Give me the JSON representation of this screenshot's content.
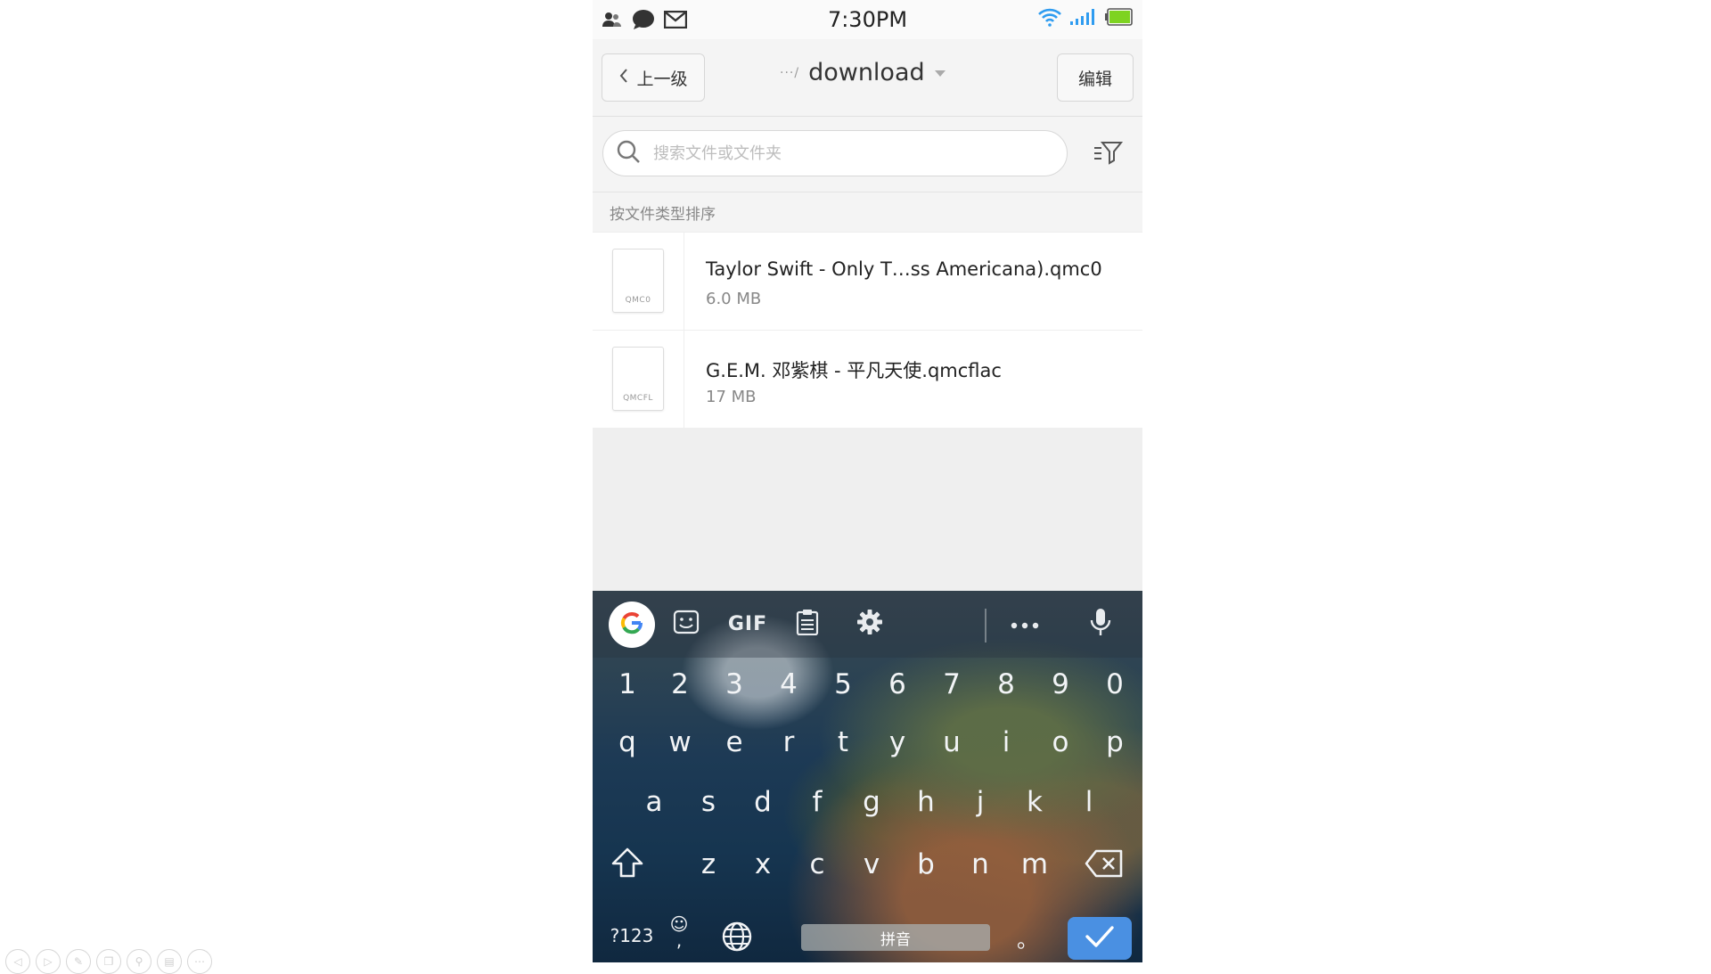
{
  "status_bar": {
    "time": "7:30PM",
    "icons_left": [
      "contacts-icon",
      "chat-icon",
      "mail-icon"
    ],
    "icons_right": [
      "wifi-icon",
      "signal-icon",
      "battery-icon"
    ]
  },
  "title_bar": {
    "back_label": "上一级",
    "path_ellipsis": "···/",
    "current_folder": "download",
    "edit_label": "编辑"
  },
  "search": {
    "placeholder": "搜索文件或文件夹"
  },
  "sort_label": "按文件类型排序",
  "files": [
    {
      "name": "Taylor Swift - Only T…ss Americana).qmc0",
      "size": "6.0 MB",
      "ext": "QMC0"
    },
    {
      "name": "G.E.M. 邓紫棋 - 平凡天使.qmcflac",
      "size": "17 MB",
      "ext": "QMCFL"
    }
  ],
  "keyboard": {
    "toolbar": {
      "gif_label": "GIF",
      "icons": [
        "google-icon",
        "sticker-icon",
        "gif-icon",
        "clipboard-icon",
        "settings-gear-icon",
        "more-icon",
        "mic-icon"
      ]
    },
    "row_numbers": [
      "1",
      "2",
      "3",
      "4",
      "5",
      "6",
      "7",
      "8",
      "9",
      "0"
    ],
    "row_1": [
      "q",
      "w",
      "e",
      "r",
      "t",
      "y",
      "u",
      "i",
      "o",
      "p"
    ],
    "row_2": [
      "a",
      "s",
      "d",
      "f",
      "g",
      "h",
      "j",
      "k",
      "l"
    ],
    "row_3": [
      "z",
      "x",
      "c",
      "v",
      "b",
      "n",
      "m"
    ],
    "symbols_label": "?123",
    "emoji_label": "☺",
    "comma_label": ",",
    "space_label": "拼音",
    "period_label": "。"
  },
  "colors": {
    "accent_blue": "#4a90e2",
    "wifi_blue": "#2f9cf0",
    "battery_green": "#7ed321"
  }
}
